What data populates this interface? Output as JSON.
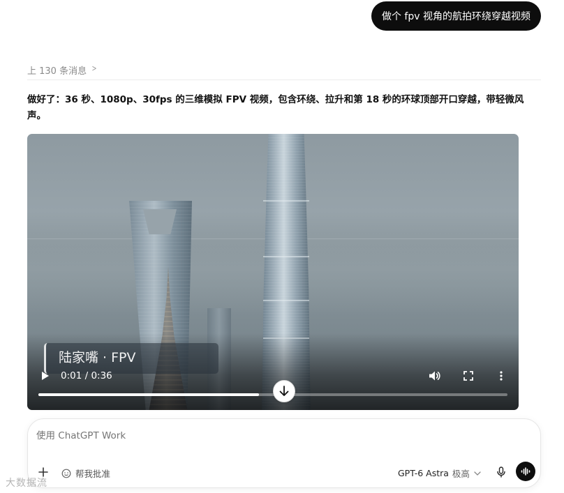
{
  "user_message": "做个 fpv 视角的航拍环绕穿越视频",
  "history": {
    "label": "上 130 条消息"
  },
  "assistant": {
    "text": "做好了：36 秒、1080p、30fps 的三维模拟 FPV 视频，包含环绕、拉升和第 18 秒的环球顶部开口穿越，带轻微风声。"
  },
  "video": {
    "overlay_title": "陆家嘴 · FPV",
    "current_time": "0:01",
    "duration": "0:36",
    "time_display": "0:01 / 0:36",
    "buffered_fraction": 0.47,
    "controls": [
      "play-icon",
      "volume-icon",
      "fullscreen-icon",
      "more-vertical-icon"
    ]
  },
  "composer": {
    "placeholder": "使用 ChatGPT Work",
    "approve_label": "帮我批准",
    "model_name": "GPT-6 Astra",
    "model_level": "极高"
  },
  "watermark": "大数据流"
}
